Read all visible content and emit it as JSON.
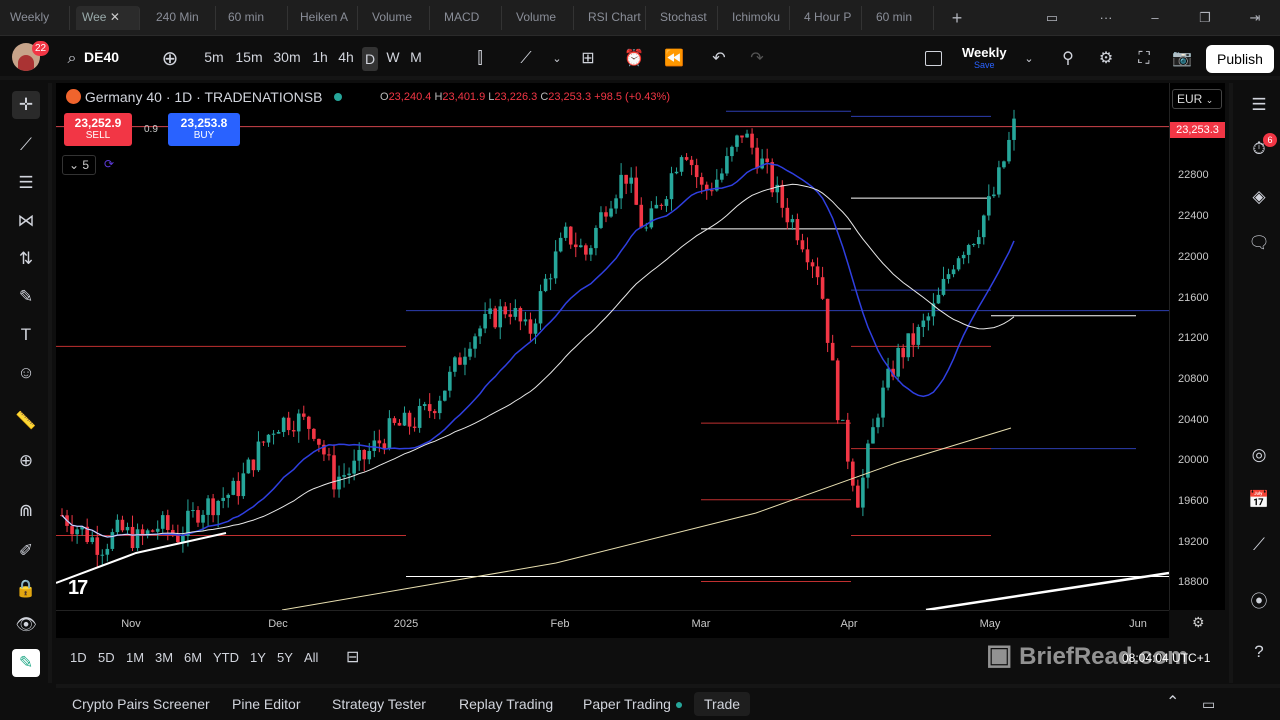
{
  "tabs": [
    "Weekly",
    "Wee",
    "240 Min",
    "60 min",
    "Heiken A",
    "Volume",
    "MACD",
    "Volume",
    "RSI Chart",
    "Stochast",
    "Ichimoku",
    "4 Hour P",
    "60 min"
  ],
  "header": {
    "avatar_badge": "22",
    "symbol": "DE40",
    "timeframes": [
      "5m",
      "15m",
      "30m",
      "1h",
      "4h",
      "D",
      "W",
      "M"
    ],
    "active_timeframe": "D",
    "layout_name": "Weekly",
    "layout_sub": "Save",
    "publish_label": "Publish"
  },
  "legend": {
    "title": "Germany 40 · 1D · TRADENATIONSB",
    "o_label": "O",
    "o_value": "23,240.4",
    "h_label": "H",
    "h_value": "23,401.9",
    "l_label": "L",
    "l_value": "23,226.3",
    "c_label": "C",
    "c_value": "23,253.3",
    "change": "+98.5 (+0.43%)",
    "sell_price": "23,252.9",
    "sell_label": "SELL",
    "spread": "0.9",
    "buy_price": "23,253.8",
    "buy_label": "BUY",
    "indicator_count": "5"
  },
  "currency": "EUR",
  "last_price": "23,253.3",
  "alert_badge": "6",
  "chart_data": {
    "type": "candlestick",
    "symbol": "Germany 40",
    "yticks": [
      22800,
      22400,
      22000,
      21600,
      21200,
      20800,
      20400,
      20000,
      19600,
      19200,
      18800
    ],
    "xticks": [
      "Nov",
      "Dec",
      "2025",
      "Feb",
      "Mar",
      "Apr",
      "May",
      "Jun"
    ],
    "close_path": [
      19450,
      19300,
      19150,
      19300,
      19200,
      19350,
      19250,
      19500,
      19600,
      19700,
      20050,
      20350,
      20400,
      20300,
      19800,
      19900,
      20100,
      20300,
      20350,
      20500,
      20800,
      21200,
      21350,
      21500,
      21200,
      21800,
      22200,
      22000,
      22500,
      22800,
      22200,
      22600,
      23100,
      22600,
      22800,
      23200,
      22900,
      22500,
      22200,
      21800,
      20400,
      19600,
      20500,
      21000,
      21200,
      21500,
      22000,
      22200,
      22600,
      23253
    ]
  },
  "xaxis": {
    "clock": "08:04:04 UTC+1"
  },
  "ranges": [
    "1D",
    "5D",
    "1M",
    "3M",
    "6M",
    "YTD",
    "1Y",
    "5Y",
    "All"
  ],
  "bottom": [
    "Crypto Pairs Screener",
    "Pine Editor",
    "Strategy Tester",
    "Replay Trading",
    "Paper Trading",
    "Trade"
  ],
  "watermark": "BriefRead.com",
  "tv_logo": "17"
}
